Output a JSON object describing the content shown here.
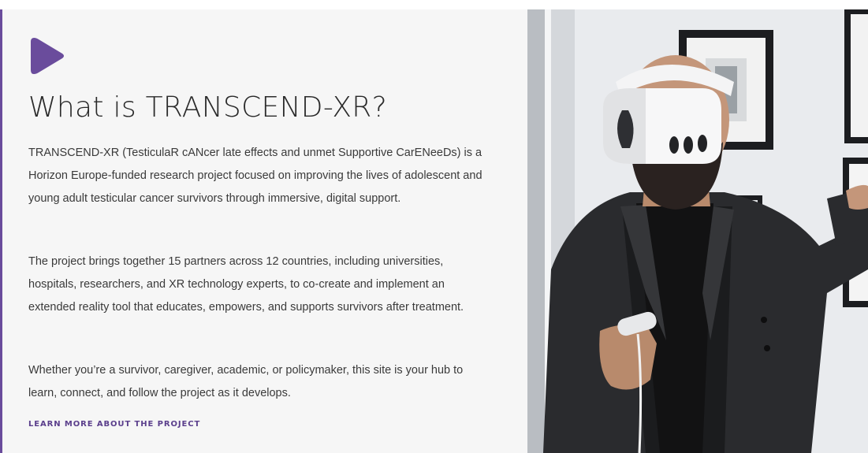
{
  "section": {
    "title": "What is TRANSCEND-XR?",
    "paragraphs": [
      "TRANSCEND-XR (TesticulaR cANcer late effects and unmet Supportive CarENeeDs) is a Horizon Europe-funded research project focused on improving the lives of adolescent and young adult testicular cancer survivors through immersive, digital support.",
      "The project brings together 15 partners across 12 countries, including universities, hospitals, researchers, and XR technology experts, to co-create and implement an extended reality tool that educates, empowers, and supports survivors after treatment.",
      "Whether you’re a survivor, caregiver, academic, or policymaker, this site is your hub to learn, connect, and follow the project as it develops."
    ],
    "cta_label": "LEARN MORE ABOUT THE PROJECT"
  },
  "icons": {
    "accent": "play-icon"
  },
  "colors": {
    "accent": "#6a4c9c",
    "cta": "#5b3f8c",
    "panel_bg": "#f6f6f6",
    "heading": "#2a2a2a",
    "body_text": "#3a3a3a"
  }
}
